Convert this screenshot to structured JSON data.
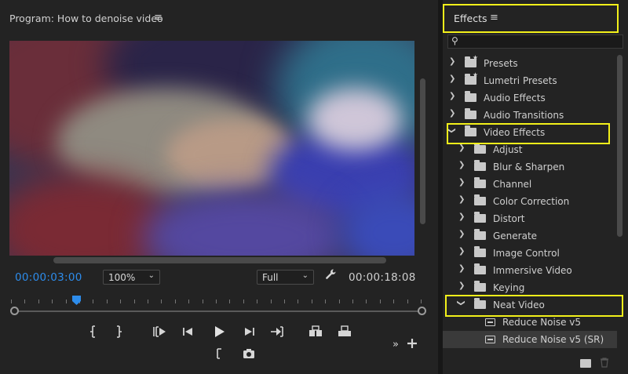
{
  "program": {
    "title": "Program: How to denoise video",
    "menu_icon": "hamburger-icon",
    "timecode_current": "00:00:03:00",
    "zoom": "100%",
    "resolution": "Full",
    "timecode_duration": "00:00:18:08",
    "transport": [
      "mark-in-icon",
      "mark-out-icon",
      "go-to-in-icon",
      "step-back-icon",
      "play-icon",
      "step-forward-icon",
      "go-to-out-icon",
      "insert-icon",
      "overwrite-icon",
      "lift-icon",
      "export-frame-icon",
      "more-icon",
      "add-button-icon"
    ],
    "playhead_position": 0.15
  },
  "effects": {
    "title": "Effects",
    "menu_icon": "hamburger-icon",
    "search_placeholder": "",
    "tree": [
      {
        "label": "Presets",
        "depth": 0,
        "expanded": false,
        "icon": "preset-folder-icon"
      },
      {
        "label": "Lumetri Presets",
        "depth": 0,
        "expanded": false,
        "icon": "preset-folder-icon"
      },
      {
        "label": "Audio Effects",
        "depth": 0,
        "expanded": false,
        "icon": "folder-icon"
      },
      {
        "label": "Audio Transitions",
        "depth": 0,
        "expanded": false,
        "icon": "folder-icon"
      },
      {
        "label": "Video Effects",
        "depth": 0,
        "expanded": true,
        "icon": "folder-icon"
      },
      {
        "label": "Adjust",
        "depth": 1,
        "expanded": false,
        "icon": "folder-icon"
      },
      {
        "label": "Blur & Sharpen",
        "depth": 1,
        "expanded": false,
        "icon": "folder-icon"
      },
      {
        "label": "Channel",
        "depth": 1,
        "expanded": false,
        "icon": "folder-icon"
      },
      {
        "label": "Color Correction",
        "depth": 1,
        "expanded": false,
        "icon": "folder-icon"
      },
      {
        "label": "Distort",
        "depth": 1,
        "expanded": false,
        "icon": "folder-icon"
      },
      {
        "label": "Generate",
        "depth": 1,
        "expanded": false,
        "icon": "folder-icon"
      },
      {
        "label": "Image Control",
        "depth": 1,
        "expanded": false,
        "icon": "folder-icon"
      },
      {
        "label": "Immersive Video",
        "depth": 1,
        "expanded": false,
        "icon": "folder-icon"
      },
      {
        "label": "Keying",
        "depth": 1,
        "expanded": false,
        "icon": "folder-icon"
      },
      {
        "label": "Neat Video",
        "depth": 1,
        "expanded": true,
        "icon": "folder-icon"
      },
      {
        "label": "Reduce Noise v5",
        "depth": 2,
        "icon": "effect-icon"
      },
      {
        "label": "Reduce Noise v5 (SR)",
        "depth": 2,
        "icon": "effect-icon",
        "selected": true
      }
    ],
    "footer_icons": [
      "new-bin-icon",
      "trash-icon"
    ]
  },
  "colors": {
    "accent_timecode": "#2d8ceb",
    "highlight": "#f2f01a",
    "panel_bg": "#232323"
  }
}
